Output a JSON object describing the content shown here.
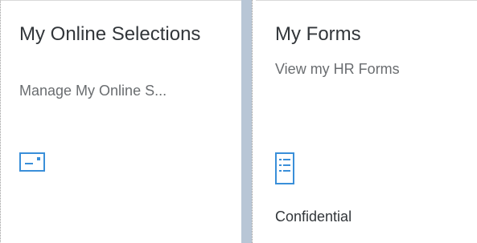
{
  "tiles": [
    {
      "title": "My Online Selections",
      "subtitle": "Manage My Online S...",
      "icon": "card-icon",
      "footer": ""
    },
    {
      "title": "My Forms",
      "subtitle": "View my HR Forms",
      "icon": "form-list-icon",
      "footer": "Confidential"
    }
  ],
  "colors": {
    "accent_icon": "#3a8fd9",
    "divider": "#b8c6d6",
    "title_text": "#32363a",
    "subtitle_text": "#6a6d70"
  }
}
